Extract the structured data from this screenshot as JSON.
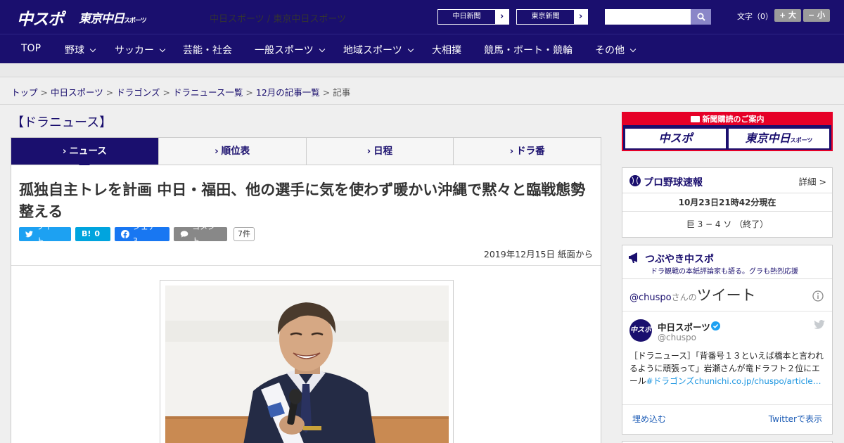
{
  "header": {
    "logo_chuspo": "中スポ",
    "logo_tokyo_main": "東京中日",
    "logo_tokyo_sub": "スポーツ",
    "site_link": "中日スポーツ / 東京中日スポーツ",
    "paper_buttons": [
      "中日新聞",
      "東京新聞"
    ],
    "search": {
      "placeholder": ""
    },
    "fontsize": {
      "label": "文字（0）",
      "larger": "+ 大",
      "smaller": "− 小"
    }
  },
  "nav": {
    "items": [
      {
        "label": "TOP",
        "dropdown": false
      },
      {
        "label": "野球",
        "dropdown": true
      },
      {
        "label": "サッカー",
        "dropdown": true
      },
      {
        "label": "芸能・社会",
        "dropdown": false
      },
      {
        "label": "一般スポーツ",
        "dropdown": true
      },
      {
        "label": "地域スポーツ",
        "dropdown": true
      },
      {
        "label": "大相撲",
        "dropdown": false
      },
      {
        "label": "競馬・ボート・競輪",
        "dropdown": false
      },
      {
        "label": "その他",
        "dropdown": true
      }
    ]
  },
  "breadcrumb": {
    "items": [
      "トップ",
      "中日スポーツ",
      "ドラゴンズ",
      "ドラニュース一覧",
      "12月の記事一覧"
    ],
    "current": "記事",
    "separator": ">"
  },
  "section_title": "【ドラニュース】",
  "tabs": [
    {
      "label": "ニュース",
      "active": true
    },
    {
      "label": "順位表",
      "active": false
    },
    {
      "label": "日程",
      "active": false
    },
    {
      "label": "ドラ番",
      "active": false
    }
  ],
  "article": {
    "headline": "孤独自主トレを計画 中日・福田、他の選手に気を使わず暖かい沖縄で黙々と臨戦態勢整える",
    "share": {
      "tweet": "ツイート",
      "hatena_count": "0",
      "facebook": "シェア 3",
      "comment": "コメント",
      "comment_count": "7件"
    },
    "pubdate": "2019年12月15日 紙面から"
  },
  "sidebar": {
    "ad": {
      "title": "新聞購読のご案内",
      "logo_left": "中スポ",
      "logo_right_main": "東京中日",
      "logo_right_sub": "スポーツ"
    },
    "baseball": {
      "title": "プロ野球速報",
      "more": "詳細 >",
      "timestamp": "10月23日21時42分現在",
      "score": "巨 3 − 4 ソ （終了）"
    },
    "tsubuyaki": {
      "title": "つぶやき中スポ",
      "subtitle": "ドラ観戦の本紙評論家も語る。グラも熱烈応援",
      "handle": "@chuspo",
      "handle_suffix": "さんの",
      "tweet_word": "ツイート",
      "account_name": "中日スポーツ",
      "account_handle": "@chuspo",
      "tweet_text_a": "［ドラニュース］「背番号１３といえば橋本と言われるように頑張って」岩瀬さんが竜ドラフト２位にエール",
      "tweet_hashtag": "#ドラゴンズ",
      "tweet_link": "chunichi.co.jp/chuspo/article…",
      "embed": "埋め込む",
      "view_on": "Twitterで表示"
    }
  },
  "colors": {
    "brand_navy": "#1a0f6e",
    "ad_red": "#e60027",
    "twitter_blue": "#1da1f2"
  }
}
